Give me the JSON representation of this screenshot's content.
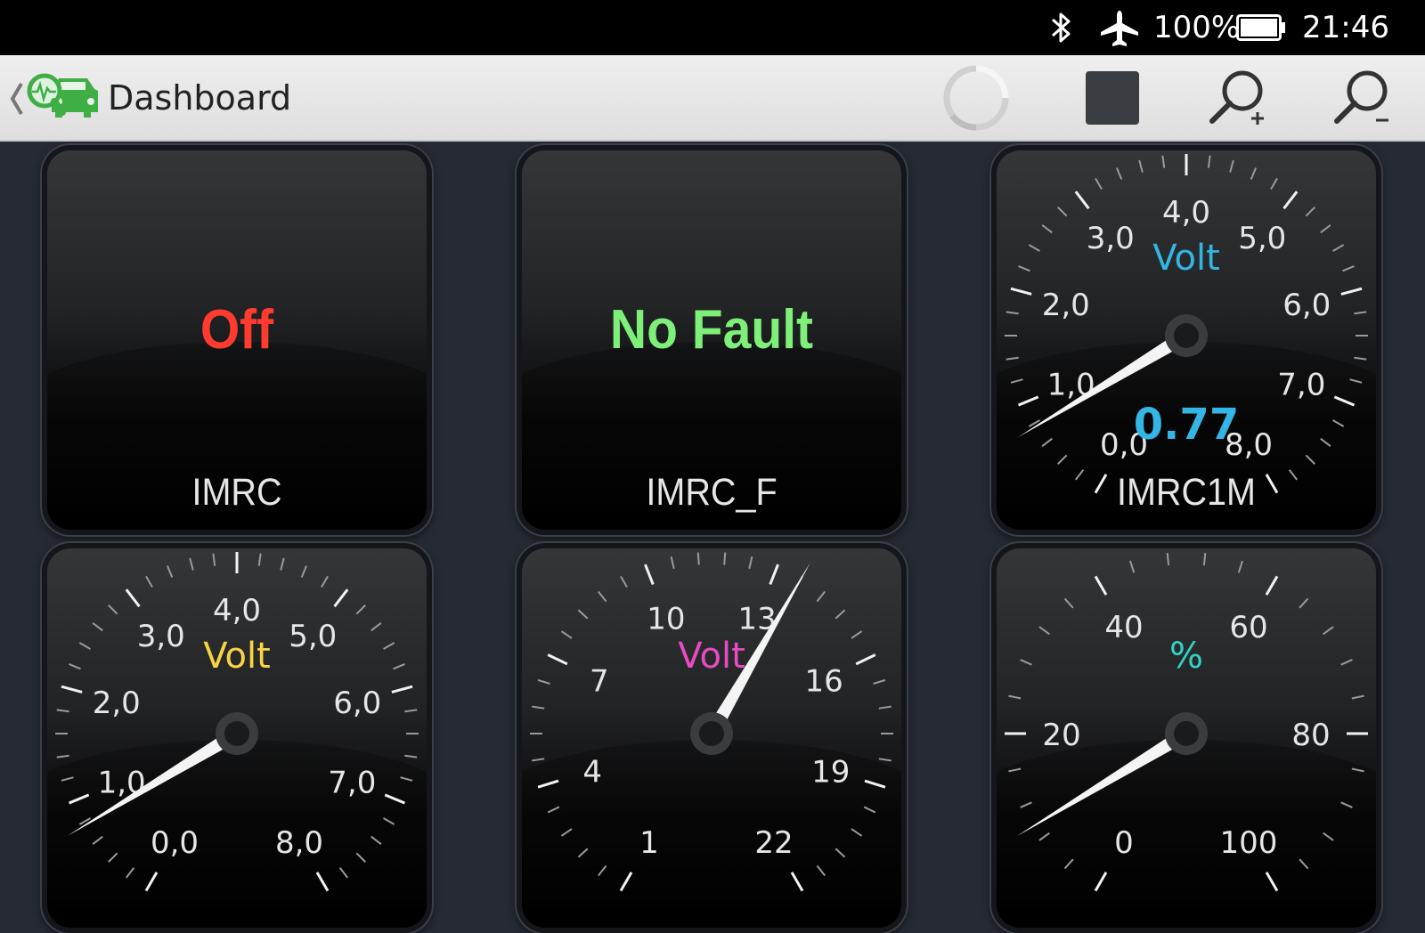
{
  "status_bar": {
    "icons": [
      "bluetooth-icon",
      "airplane-mode-icon",
      "battery-icon"
    ],
    "battery_text": "100%",
    "time": "21:46"
  },
  "action_bar": {
    "icons": [
      "back-chevron-icon",
      "app-logo-icon",
      "loading-spinner-icon",
      "stop-icon",
      "zoom-in-icon",
      "zoom-out-icon"
    ],
    "title": "Dashboard"
  },
  "panels": [
    {
      "name": "IMRC",
      "type": "text",
      "value": "Off",
      "value_color": "#ff3b30"
    },
    {
      "name": "IMRC_F",
      "type": "text",
      "value": "No Fault",
      "value_color": "#7ef07a"
    },
    {
      "name": "IMRC1M",
      "type": "gauge",
      "unit": "Volt",
      "unit_color": "#33b5e5",
      "value": "0.77",
      "value_color": "#33b5e5",
      "reading": 0.77,
      "min": 0,
      "max": 8,
      "tick_labels": [
        "0,0",
        "1,0",
        "2,0",
        "3,0",
        "4,0",
        "5,0",
        "6,0",
        "7,0",
        "8,0"
      ]
    },
    {
      "name": "",
      "type": "gauge",
      "unit": "Volt",
      "unit_color": "#f7d443",
      "value": "",
      "value_color": "#f7d443",
      "reading": 0.77,
      "min": 0,
      "max": 8,
      "tick_labels": [
        "0,0",
        "1,0",
        "2,0",
        "3,0",
        "4,0",
        "5,0",
        "6,0",
        "7,0",
        "8,0"
      ]
    },
    {
      "name": "",
      "type": "gauge",
      "unit": "Volt",
      "unit_color": "#e84bc3",
      "value": "",
      "value_color": "#e84bc3",
      "reading": 13.6,
      "min": 1,
      "max": 22,
      "tick_labels": [
        "1",
        "4",
        "7",
        "10",
        "13",
        "16",
        "19",
        "22"
      ]
    },
    {
      "name": "",
      "type": "gauge",
      "unit": "%",
      "unit_color": "#33d1c4",
      "value": "",
      "value_color": "#33d1c4",
      "reading": 9.6,
      "min": 0,
      "max": 100,
      "tick_labels": [
        "0",
        "20",
        "40",
        "60",
        "80",
        "100"
      ]
    }
  ]
}
